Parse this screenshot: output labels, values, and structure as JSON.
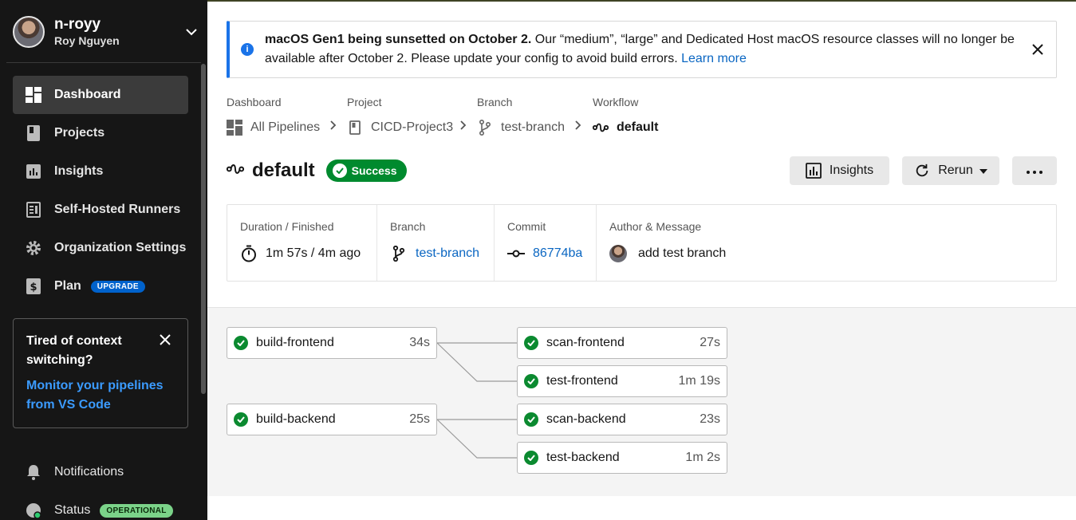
{
  "sidebar": {
    "user": {
      "username": "n-royy",
      "full_name": "Roy Nguyen"
    },
    "nav": [
      {
        "label": "Dashboard",
        "icon": "dashboard-icon",
        "active": true
      },
      {
        "label": "Projects",
        "icon": "projects-icon"
      },
      {
        "label": "Insights",
        "icon": "insights-icon"
      },
      {
        "label": "Self-Hosted Runners",
        "icon": "runners-icon"
      },
      {
        "label": "Organization Settings",
        "icon": "gear-icon"
      },
      {
        "label": "Plan",
        "icon": "plan-icon",
        "badge": "UPGRADE"
      }
    ],
    "promo": {
      "title": "Tired of context switching?",
      "link": "Monitor your pipelines from VS Code"
    },
    "bottom": [
      {
        "label": "Notifications",
        "icon": "bell-icon"
      },
      {
        "label": "Status",
        "icon": "status-icon",
        "badge": "OPERATIONAL"
      }
    ]
  },
  "banner": {
    "bold": "macOS Gen1 being sunsetted on October 2.",
    "text": " Our “medium”, “large” and Dedicated Host macOS resource classes will no longer be available after October 2. Please update your config to avoid build errors. ",
    "link": "Learn more"
  },
  "breadcrumb": [
    {
      "label": "Dashboard",
      "value": "All Pipelines"
    },
    {
      "label": "Project",
      "value": "CICD-Project3"
    },
    {
      "label": "Branch",
      "value": "test-branch"
    },
    {
      "label": "Workflow",
      "value": "default"
    }
  ],
  "workflow": {
    "name": "default",
    "status": "Success"
  },
  "actions": {
    "insights": "Insights",
    "rerun": "Rerun"
  },
  "meta": {
    "duration_label": "Duration / Finished",
    "duration_value": "1m 57s / 4m ago",
    "branch_label": "Branch",
    "branch_value": "test-branch",
    "commit_label": "Commit",
    "commit_value": "86774ba",
    "author_label": "Author & Message",
    "author_value": "add test branch"
  },
  "jobs": [
    {
      "name": "build-frontend",
      "duration": "34s"
    },
    {
      "name": "scan-frontend",
      "duration": "27s"
    },
    {
      "name": "test-frontend",
      "duration": "1m 19s"
    },
    {
      "name": "build-backend",
      "duration": "25s"
    },
    {
      "name": "scan-backend",
      "duration": "23s"
    },
    {
      "name": "test-backend",
      "duration": "1m 2s"
    }
  ],
  "colors": {
    "sidebar_bg": "#161616",
    "success": "#008a2e",
    "link": "#0a66c2",
    "info": "#1a73e8"
  }
}
